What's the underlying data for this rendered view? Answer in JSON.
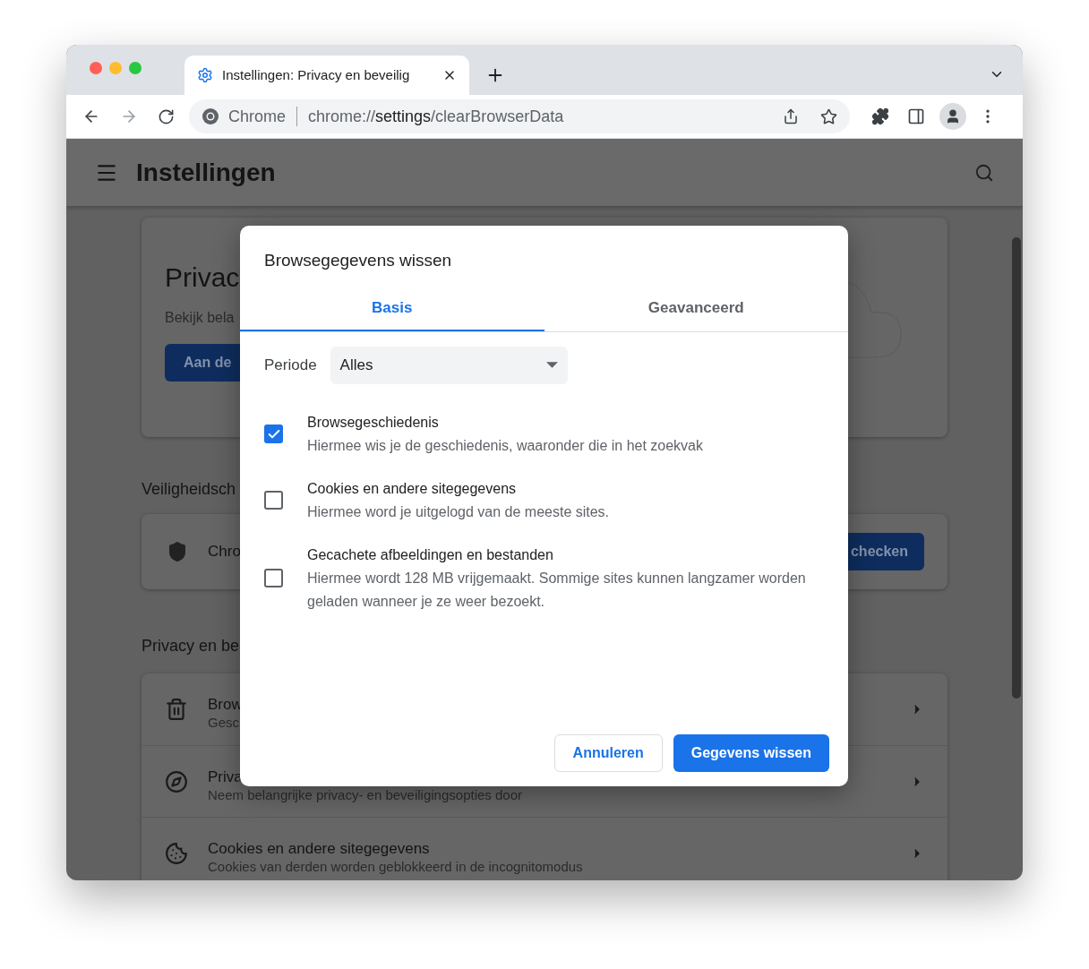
{
  "browser": {
    "tab": {
      "title": "Instellingen: Privacy en beveilig",
      "selected": true
    },
    "omnibox": {
      "chip": "Chrome",
      "url_parts": [
        {
          "text": "chrome://",
          "emphasis": false
        },
        {
          "text": "settings",
          "emphasis": true
        },
        {
          "text": "/clearBrowserData",
          "emphasis": false
        }
      ]
    }
  },
  "settings": {
    "title": "Instellingen",
    "privacy_card": {
      "title": "Privac",
      "subtitle": "Bekijk bela",
      "button": "Aan de"
    },
    "safety_heading": "Veiligheidsch",
    "safety_card": {
      "label": "Chro",
      "button": "checken"
    },
    "privacy_heading": "Privacy en be",
    "rows": [
      {
        "title": "Brow",
        "subtitle": "Gesc"
      },
      {
        "title": "Priva",
        "subtitle": "Neem belangrijke privacy- en beveiligingsopties door"
      },
      {
        "title": "Cookies en andere sitegegevens",
        "subtitle": "Cookies van derden worden geblokkeerd in de incognitomodus"
      }
    ]
  },
  "dialog": {
    "title": "Browsegegevens wissen",
    "tabs": [
      {
        "label": "Basis",
        "selected": true
      },
      {
        "label": "Geavanceerd",
        "selected": false
      }
    ],
    "period": {
      "label": "Periode",
      "value": "Alles"
    },
    "options": [
      {
        "title": "Browsegeschiedenis",
        "description": "Hiermee wis je de geschiedenis, waaronder die in het zoekvak",
        "checked": true
      },
      {
        "title": "Cookies en andere sitegegevens",
        "description": "Hiermee word je uitgelogd van de meeste sites.",
        "checked": false
      },
      {
        "title": "Gecachete afbeeldingen en bestanden",
        "description": "Hiermee wordt 128 MB vrijgemaakt. Sommige sites kunnen langzamer worden geladen wanneer je ze weer bezoekt.",
        "checked": false
      }
    ],
    "buttons": [
      {
        "label": "Annuleren",
        "kind": "secondary"
      },
      {
        "label": "Gegevens wissen",
        "kind": "primary"
      }
    ]
  }
}
